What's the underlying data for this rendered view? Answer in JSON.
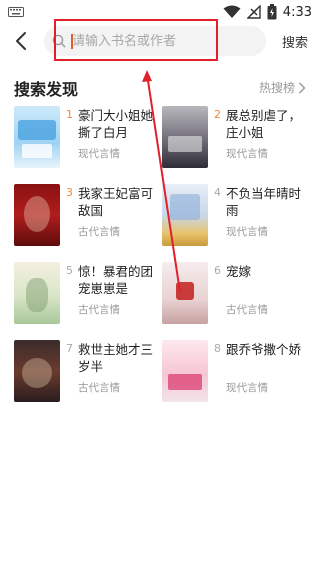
{
  "status_bar": {
    "time": "4:33",
    "icons": [
      "wifi-icon",
      "signal-icon",
      "battery-icon"
    ]
  },
  "search": {
    "placeholder": "请输入书名或作者",
    "button_label": "搜索"
  },
  "section": {
    "title": "搜索发现",
    "more_label": "热搜榜"
  },
  "books": [
    {
      "rank": "1",
      "title": "豪门大小姐她撕了白月",
      "category": "现代言情",
      "cover": "cover-sky"
    },
    {
      "rank": "2",
      "title": "展总别虐了，庄小姐",
      "category": "现代言情",
      "cover": "cover-dark-night"
    },
    {
      "rank": "3",
      "title": "我家王妃富可敌国",
      "category": "古代言情",
      "cover": "cover-red"
    },
    {
      "rank": "4",
      "title": "不负当年晴时雨",
      "category": "现代言情",
      "cover": "cover-blue-gold"
    },
    {
      "rank": "5",
      "title": "惊！暴君的团宠崽崽是",
      "category": "古代言情",
      "cover": "cover-green-cream"
    },
    {
      "rank": "6",
      "title": "宠嫁",
      "category": "古代言情",
      "cover": "cover-red-seal"
    },
    {
      "rank": "7",
      "title": "救世主她才三岁半",
      "category": "古代言情",
      "cover": "cover-dark-palace"
    },
    {
      "rank": "8",
      "title": "跟乔爷撒个娇",
      "category": "现代言情",
      "cover": "cover-pink"
    }
  ],
  "colors": {
    "accent": "#f08a3c",
    "annotation": "#e0202a"
  }
}
